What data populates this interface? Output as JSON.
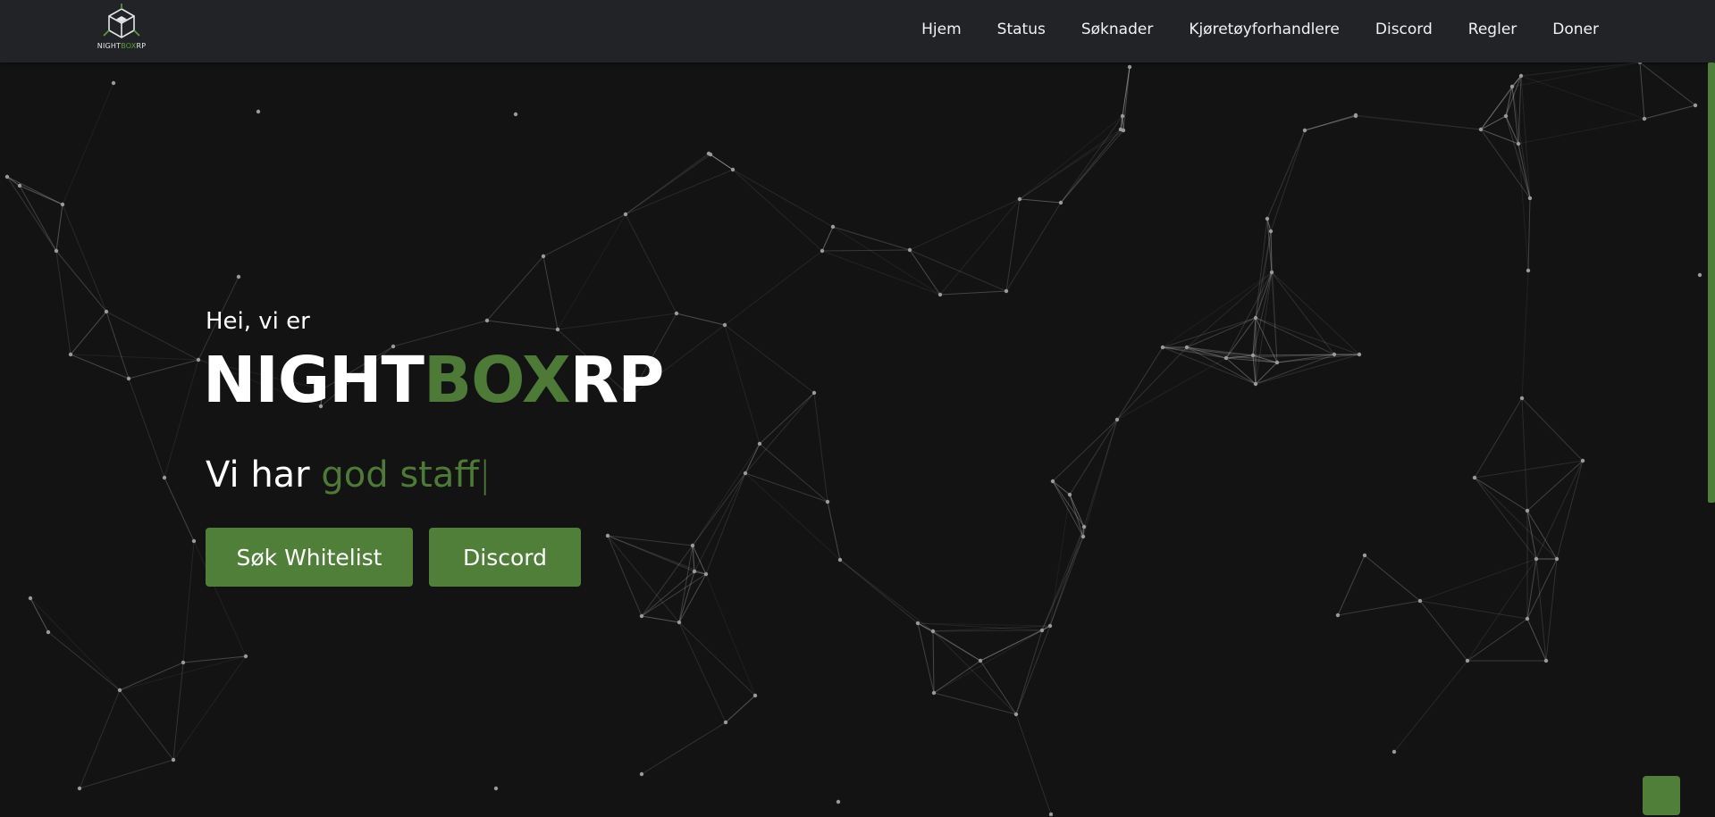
{
  "brand": {
    "logo_text_white_1": "NIGHT",
    "logo_text_green": "BOX",
    "logo_text_white_2": "RP"
  },
  "nav": {
    "items": [
      {
        "label": "Hjem"
      },
      {
        "label": "Status"
      },
      {
        "label": "Søknader"
      },
      {
        "label": "Kjøretøyforhandlere"
      },
      {
        "label": "Discord"
      },
      {
        "label": "Regler"
      },
      {
        "label": "Doner"
      }
    ]
  },
  "hero": {
    "greeting": "Hei, vi er",
    "title_part1": "NIGHT",
    "title_part2": "BOX",
    "title_part3": "RP",
    "tagline_prefix": "Vi har ",
    "tagline_typed": "god staff",
    "tagline_cursor": "|",
    "buttons": {
      "whitelist": "Søk Whitelist",
      "discord": "Discord"
    }
  },
  "colors": {
    "accent": "#507f39",
    "accent_text": "#4d7a37",
    "background": "#131313",
    "navbar": "#222326"
  },
  "icons": {
    "logo": "cube-icon",
    "scroll_top": "scroll-to-top-icon"
  }
}
